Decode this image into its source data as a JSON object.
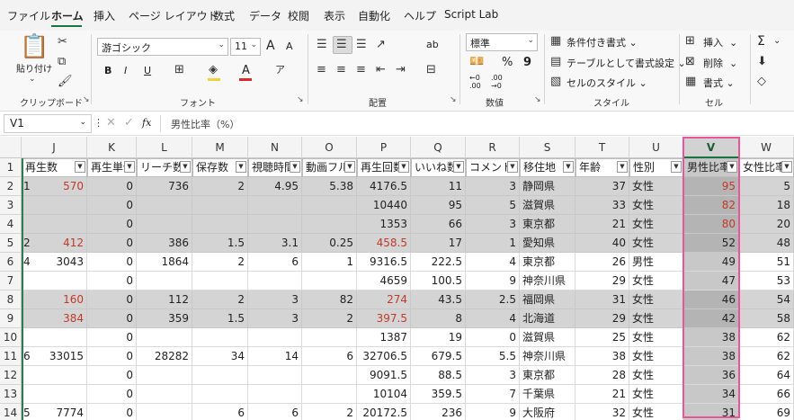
{
  "menu": {
    "tabs": [
      "ファイル",
      "ホーム",
      "挿入",
      "ページ レイアウト",
      "数式",
      "データ",
      "校閲",
      "表示",
      "自動化",
      "ヘルプ",
      "Script Lab"
    ],
    "active_index": 1
  },
  "ribbon": {
    "clipboard": {
      "paste_label": "貼り付け",
      "group_label": "クリップボード"
    },
    "font": {
      "font_name": "游ゴシック",
      "font_size": "11",
      "group_label": "フォント",
      "bold": "B",
      "italic": "I",
      "underline": "U",
      "grow": "A",
      "shrink": "A",
      "font_color_glyph": "A"
    },
    "alignment": {
      "group_label": "配置",
      "wrap_glyph": "ab"
    },
    "number": {
      "format": "標準",
      "percent": "%",
      "comma": "9",
      "group_label": "数値",
      "inc_decimal": "←0\n.00",
      "dec_decimal": ".00\n→0"
    },
    "styles": {
      "conditional": "条件付き書式",
      "table": "テーブルとして書式設定",
      "cell_styles": "セルのスタイル",
      "group_label": "スタイル"
    },
    "cells": {
      "insert": "挿入",
      "delete": "削除",
      "format": "書式",
      "group_label": "セル"
    },
    "editing": {
      "sum_glyph": "Σ"
    }
  },
  "formula_bar": {
    "name_box": "V1",
    "fx": "fx",
    "content": "男性比率（%）"
  },
  "sheet": {
    "columns": [
      "J",
      "K",
      "L",
      "M",
      "N",
      "O",
      "P",
      "Q",
      "R",
      "S",
      "T",
      "U",
      "V",
      "W"
    ],
    "selected_column": "V",
    "row_numbers": [
      "1",
      "2",
      "3",
      "4",
      "5",
      "6",
      "7",
      "8",
      "9",
      "10",
      "11",
      "12",
      "13",
      "14"
    ],
    "headers": [
      "再生数",
      "再生単価",
      "リーチ数",
      "保存数",
      "視聴時間",
      "動画フル",
      "再生回数",
      "いいね数",
      "コメント",
      "移住地",
      "年齢",
      "性別",
      "男性比率",
      "女性比率"
    ],
    "row_prefix": [
      "",
      "1",
      "",
      "",
      "2",
      "4",
      "",
      "",
      "",
      "",
      "6",
      "",
      "",
      "5"
    ],
    "rows": [
      [
        "570",
        "0",
        "736",
        "2",
        "4.95",
        "5.38",
        "4176.5",
        "11",
        "3",
        "静岡県",
        "37",
        "女性",
        "95",
        "5"
      ],
      [
        "",
        "0",
        "",
        "",
        "",
        "",
        "10440",
        "95",
        "5",
        "滋賀県",
        "33",
        "女性",
        "82",
        "18"
      ],
      [
        "",
        "0",
        "",
        "",
        "",
        "",
        "1353",
        "66",
        "3",
        "東京都",
        "21",
        "女性",
        "80",
        "20"
      ],
      [
        "412",
        "0",
        "386",
        "1.5",
        "3.1",
        "0.25",
        "458.5",
        "17",
        "1",
        "愛知県",
        "40",
        "女性",
        "52",
        "48"
      ],
      [
        "3043",
        "0",
        "1864",
        "2",
        "6",
        "1",
        "9316.5",
        "222.5",
        "4",
        "東京都",
        "26",
        "男性",
        "49",
        "51"
      ],
      [
        "",
        "0",
        "",
        "",
        "",
        "",
        "4659",
        "100.5",
        "9",
        "神奈川県",
        "29",
        "女性",
        "47",
        "53"
      ],
      [
        "160",
        "0",
        "112",
        "2",
        "3",
        "82",
        "274",
        "43.5",
        "2.5",
        "福岡県",
        "31",
        "女性",
        "46",
        "54"
      ],
      [
        "384",
        "0",
        "359",
        "1.5",
        "3",
        "2",
        "397.5",
        "8",
        "4",
        "北海道",
        "29",
        "女性",
        "42",
        "58"
      ],
      [
        "",
        "0",
        "",
        "",
        "",
        "",
        "1387",
        "19",
        "0",
        "滋賀県",
        "25",
        "女性",
        "38",
        "62"
      ],
      [
        "33015",
        "0",
        "28282",
        "34",
        "14",
        "6",
        "32706.5",
        "679.5",
        "5.5",
        "神奈川県",
        "38",
        "女性",
        "38",
        "62"
      ],
      [
        "",
        "0",
        "",
        "",
        "",
        "",
        "9091.5",
        "88.5",
        "3",
        "東京都",
        "28",
        "女性",
        "36",
        "64"
      ],
      [
        "",
        "0",
        "",
        "",
        "",
        "",
        "10104",
        "359.5",
        "7",
        "千葉県",
        "21",
        "女性",
        "34",
        "66"
      ],
      [
        "7774",
        "0",
        "",
        "6",
        "6",
        "2",
        "20172.5",
        "236",
        "9",
        "大阪府",
        "32",
        "女性",
        "31",
        "69"
      ]
    ],
    "shaded_rows": [
      0,
      1,
      2,
      3,
      6,
      7
    ],
    "red_cells": [
      [
        0,
        0
      ],
      [
        3,
        0
      ],
      [
        6,
        0
      ],
      [
        7,
        0
      ],
      [
        3,
        6
      ],
      [
        6,
        6
      ],
      [
        7,
        6
      ],
      [
        0,
        12
      ],
      [
        1,
        12
      ],
      [
        2,
        12
      ]
    ],
    "colors": {
      "accent": "#1a7342",
      "highlight": "#e8559a",
      "red_text": "#c0392b"
    }
  }
}
